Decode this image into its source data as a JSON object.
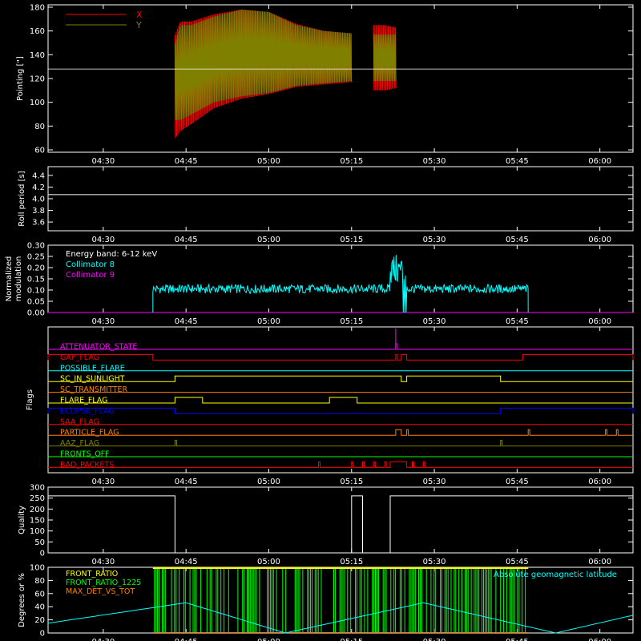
{
  "time_axis": {
    "tick_labels": [
      "04:30",
      "04:45",
      "05:00",
      "05:15",
      "05:30",
      "05:45",
      "06:00"
    ],
    "tick_minutes": [
      270,
      285,
      300,
      315,
      330,
      345,
      360
    ],
    "range_minutes": [
      260,
      366
    ]
  },
  "chart_data": [
    {
      "type": "line",
      "ylabel": "Pointing [\"]",
      "ylim": [
        58,
        182
      ],
      "yticks": [
        60,
        80,
        100,
        120,
        140,
        160,
        180
      ],
      "reference_line": 128,
      "legend_placement": "top-left",
      "series": [
        {
          "name": "X",
          "color": "#ff0000",
          "x": [
            "04:43",
            "04:44",
            "04:46",
            "04:50",
            "04:55",
            "05:00",
            "05:05",
            "05:10",
            "05:15",
            "05:16",
            "05:19",
            "05:21",
            "05:23"
          ],
          "y_max": [
            157,
            168,
            168,
            174,
            178,
            176,
            166,
            160,
            158,
            0,
            165,
            165,
            163
          ],
          "y_min": [
            70,
            76,
            82,
            95,
            103,
            107,
            113,
            115,
            117,
            0,
            110,
            110,
            112
          ]
        },
        {
          "name": "Y",
          "color": "#808000",
          "x": [
            "04:43",
            "04:44",
            "04:46",
            "04:50",
            "04:55",
            "05:00",
            "05:05",
            "05:10",
            "05:15",
            "05:16",
            "05:19",
            "05:21",
            "05:23"
          ],
          "y_max": [
            150,
            165,
            165,
            172,
            178,
            176,
            165,
            160,
            158,
            0,
            157,
            157,
            157
          ],
          "y_min": [
            85,
            85,
            90,
            100,
            105,
            108,
            114,
            116,
            118,
            0,
            118,
            118,
            118
          ]
        }
      ]
    },
    {
      "type": "line",
      "ylabel": "Roll period [s]",
      "ylim": [
        3.45,
        4.55
      ],
      "yticks": [
        3.6,
        3.8,
        4.0,
        4.2,
        4.4
      ],
      "yticklabels": [
        "3.6",
        "3.8",
        "4.0",
        "4.2",
        "4.4"
      ],
      "series": [
        {
          "name": "",
          "color": "#ffffff",
          "x": [
            "04:20",
            "06:06"
          ],
          "y": [
            4.07,
            4.07
          ]
        }
      ]
    },
    {
      "type": "line",
      "ylabel": "Normalized modulation",
      "ylim": [
        0,
        0.3
      ],
      "yticks": [
        0,
        0.05,
        0.1,
        0.15,
        0.2,
        0.25,
        0.3
      ],
      "yticklabels": [
        "0.00",
        "0.05",
        "0.10",
        "0.15",
        "0.20",
        "0.25",
        "0.30"
      ],
      "legend_placement": "top-left",
      "legend_title": "Energy band: 6-12 keV",
      "series": [
        {
          "name": "Collimator 8",
          "color": "#00ffff",
          "x": [
            "04:39",
            "04:39",
            "05:23",
            "05:24",
            "05:25",
            "05:47",
            "05:47"
          ],
          "y": [
            0,
            0.105,
            0.11,
            0.25,
            0.11,
            0.105,
            0
          ]
        },
        {
          "name": "Collimator 9",
          "color": "#ff00ff",
          "x": [
            "04:20",
            "06:06"
          ],
          "y": [
            0,
            0
          ]
        }
      ]
    },
    {
      "type": "line",
      "ylabel": "Flags",
      "flags": [
        {
          "name": "ATTENUATOR_STATE",
          "color": "#ff00ff",
          "on": [
            [
              "05:23",
              "05:23"
            ]
          ]
        },
        {
          "name": "GAP_FLAG",
          "color": "#ff0000",
          "on": [
            [
              "04:20",
              "04:39"
            ],
            [
              "05:23",
              "05:23"
            ],
            [
              "05:24",
              "05:25"
            ],
            [
              "05:46",
              "06:06"
            ]
          ]
        },
        {
          "name": "POSSIBLE_FLARE",
          "color": "#00ffff",
          "on": []
        },
        {
          "name": "SC_IN_SUNLIGHT",
          "color": "#ffff00",
          "on": [
            [
              "04:43",
              "05:24"
            ],
            [
              "05:25",
              "05:42"
            ]
          ]
        },
        {
          "name": "SC_TRANSMITTER",
          "color": "#ff8000",
          "on": []
        },
        {
          "name": "FLARE_FLAG",
          "color": "#ffff00",
          "on": [
            [
              "04:43",
              "04:48"
            ],
            [
              "05:11",
              "05:16"
            ]
          ]
        },
        {
          "name": "ECLIPSE_FLAG",
          "color": "#0000ff",
          "on": [
            [
              "04:20",
              "04:43"
            ],
            [
              "05:42",
              "06:06"
            ]
          ]
        },
        {
          "name": "SAA_FLAG",
          "color": "#ff0000",
          "on": []
        },
        {
          "name": "PARTICLE_FLAG",
          "color": "#ff8000",
          "on": [
            [
              "05:23",
              "05:24"
            ],
            [
              "05:25",
              "05:25"
            ],
            [
              "05:47",
              "05:47"
            ],
            [
              "06:01",
              "06:01"
            ],
            [
              "06:03",
              "06:03"
            ]
          ]
        },
        {
          "name": "AAZ_FLAG",
          "color": "#808000",
          "on": [
            [
              "04:43",
              "04:43"
            ],
            [
              "05:42",
              "05:42"
            ]
          ]
        },
        {
          "name": "FRONTS_OFF",
          "color": "#00ff00",
          "on": []
        },
        {
          "name": "BAD_PACKETS",
          "color": "#ff0000",
          "on": [
            [
              "05:09",
              "05:09"
            ],
            [
              "05:15",
              "05:15"
            ],
            [
              "05:17",
              "05:17"
            ],
            [
              "05:19",
              "05:19"
            ],
            [
              "05:21",
              "05:21"
            ],
            [
              "05:22",
              "05:25"
            ],
            [
              "05:26",
              "05:26"
            ],
            [
              "05:28",
              "05:28"
            ]
          ]
        }
      ]
    },
    {
      "type": "line",
      "ylabel": "Quality",
      "ylim": [
        0,
        300
      ],
      "yticks": [
        0,
        50,
        100,
        150,
        200,
        250,
        300
      ],
      "series": [
        {
          "name": "",
          "color": "#ffffff",
          "x": [
            "04:20",
            "04:43",
            "04:43",
            "05:15",
            "05:15",
            "05:17",
            "05:17",
            "05:22",
            "05:22",
            "06:06"
          ],
          "y": [
            260,
            260,
            0,
            0,
            260,
            260,
            0,
            0,
            260,
            260
          ]
        }
      ]
    },
    {
      "type": "line",
      "ylabel": "Degrees or %",
      "ylim": [
        0,
        100
      ],
      "yticks": [
        0,
        20,
        40,
        60,
        80,
        100
      ],
      "legend_placement": "top-left",
      "right_label": "Absolute geomagnetic latitude",
      "series": [
        {
          "name": "FRONT_RATIO",
          "color": "#ffff00",
          "x": [
            "04:39",
            "05:47"
          ],
          "y": [
            100,
            100
          ]
        },
        {
          "name": "FRONT_RATIO_1225",
          "color": "#00ff00",
          "x": [
            "04:39",
            "05:47"
          ],
          "y": [
            100,
            100
          ]
        },
        {
          "name": "MAX_DET_VS_TOT",
          "color": "#ff8000",
          "x": [
            "04:39",
            "05:47"
          ],
          "y": [
            0,
            0
          ]
        },
        {
          "name": "Absolute geomagnetic latitude",
          "color": "#00ffff",
          "x": [
            "04:20",
            "04:45",
            "05:03",
            "05:28",
            "05:52",
            "06:06"
          ],
          "y": [
            15,
            46,
            0,
            46,
            0,
            27
          ]
        }
      ]
    }
  ]
}
